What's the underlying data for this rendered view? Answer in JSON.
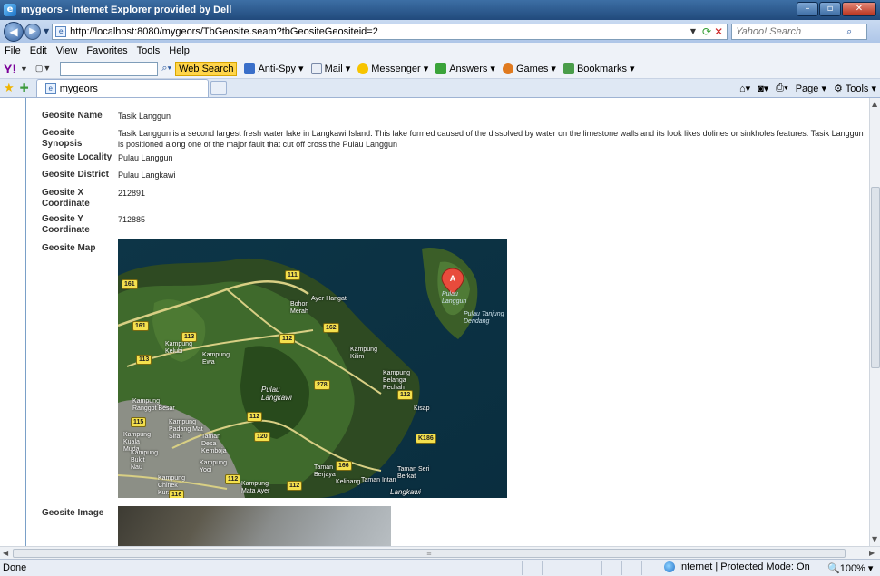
{
  "window": {
    "title": "mygeors - Internet Explorer provided by Dell",
    "controls": {
      "minimize": "–",
      "maximize": "▫",
      "close": "✕"
    }
  },
  "address_bar": {
    "url": "http://localhost:8080/mygeors/TbGeosite.seam?tbGeositeGeositeid=2",
    "search_placeholder": "Yahoo! Search"
  },
  "menu": [
    "File",
    "Edit",
    "View",
    "Favorites",
    "Tools",
    "Help"
  ],
  "yahoo_toolbar": {
    "web_search": "Web Search",
    "items": [
      "Anti-Spy",
      "Mail",
      "Messenger",
      "Answers",
      "Games",
      "Bookmarks"
    ]
  },
  "tab": {
    "title": "mygeors"
  },
  "command_bar": {
    "page": "Page",
    "tools": "Tools"
  },
  "geosite": {
    "fields": [
      {
        "label": "Geosite Name",
        "value": "Tasik Langgun"
      },
      {
        "label": "Geosite Synopsis",
        "value": "Tasik Langgun is a second largest fresh water lake in Langkawi Island. This lake formed caused of the dissolved by water on the limestone walls and its look likes dolines or sinkholes features. Tasik Langgun is positioned along one of the major fault that cut off cross the Pulau Langgun"
      },
      {
        "label": "Geosite Locality",
        "value": "Pulau Langgun"
      },
      {
        "label": "Geosite District",
        "value": "Pulau Langkawi"
      },
      {
        "label": "Geosite X Coordinate",
        "value": "212891"
      },
      {
        "label": "Geosite Y Coordinate",
        "value": "712885"
      },
      {
        "label": "Geosite Map",
        "value": ""
      },
      {
        "label": "Geosite Image",
        "value": ""
      }
    ]
  },
  "map": {
    "place_labels": [
      "Pulau Langgun",
      "Pulau Tanjung Dendang",
      "Ayer Hangat",
      "Bohor Merah",
      "Kampung Kelubi",
      "Kampung Ewa",
      "Kampung Kilim",
      "Kampung Belanga Pechah",
      "Pulau Langkawi",
      "Kisap",
      "Kampung Ranggot Besar",
      "Kampung Padang Mat Sirat",
      "Kampung Kuala Muda",
      "Taman Desa Kemboja",
      "Kampung Bukit Nau",
      "Kampung Yooi",
      "Kampung Chinek Kura",
      "Kampung Mata Ayer",
      "Taman Berjaya",
      "Kelibang",
      "Taman Intan",
      "Taman Seri Berkat",
      "Langkawi"
    ],
    "road_labels": [
      "111",
      "161",
      "161",
      "113",
      "113",
      "112",
      "162",
      "278",
      "112",
      "112",
      "115",
      "120",
      "K186",
      "166",
      "112",
      "112",
      "116"
    ],
    "marker": "A"
  },
  "statusbar": {
    "status": "Done",
    "zone": "Internet | Protected Mode: On",
    "zoom": "100%"
  },
  "colors": {
    "titlebar": "#214a7c",
    "highlight": "#ffd54a",
    "content_border": "#7aa0c8"
  }
}
